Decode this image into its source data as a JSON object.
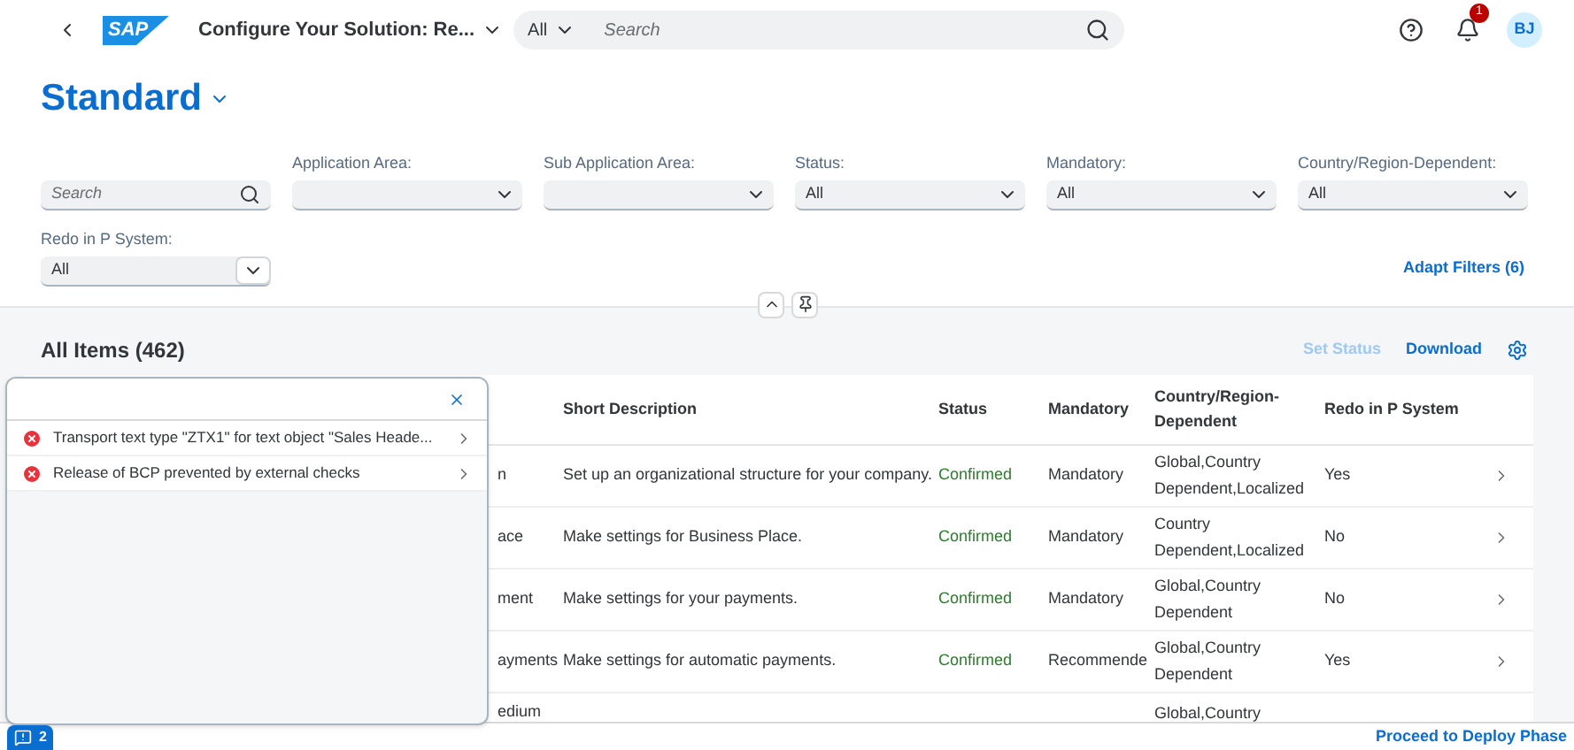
{
  "shell": {
    "logo": "SAP",
    "title": "Configure Your Solution: Re...",
    "search_scope": "All",
    "search_placeholder": "Search",
    "notification_count": "1",
    "avatar": "BJ"
  },
  "variant": {
    "title": "Standard"
  },
  "filters": [
    {
      "kind": "search",
      "placeholder": "Search"
    },
    {
      "kind": "select",
      "label": "Application Area:"
    },
    {
      "kind": "select",
      "label": "Sub Application Area:"
    },
    {
      "kind": "select",
      "label": "Status:",
      "value": "All"
    },
    {
      "kind": "select",
      "label": "Mandatory:",
      "value": "All"
    },
    {
      "kind": "select",
      "label": "Country/Region-Dependent:",
      "value": "All"
    },
    {
      "kind": "combo",
      "label": "Redo in P System:",
      "value": "All"
    }
  ],
  "adapt_filters": "Adapt Filters (6)",
  "table": {
    "title": "All Items (462)",
    "actions": [
      {
        "label": "Set Status",
        "disabled": true
      },
      {
        "label": "Download",
        "disabled": false
      }
    ],
    "columns": [
      "Short Description",
      "Status",
      "Mandatory",
      "Country/Region-Dependent",
      "Redo in P System"
    ],
    "rows": [
      {
        "column_1": "n",
        "description": "Set up an organizational structure for your company.",
        "status": "Confirmed",
        "mandatory": "Mandatory",
        "country": "Global,Country Dependent,Localized",
        "redo": "Yes"
      },
      {
        "column_1": "ace",
        "description": "Make settings for Business Place.",
        "status": "Confirmed",
        "mandatory": "Mandatory",
        "country": "Country Dependent,Localized",
        "redo": "No"
      },
      {
        "column_1": "ment",
        "description": "Make settings for your payments.",
        "status": "Confirmed",
        "mandatory": "Mandatory",
        "country": "Global,Country Dependent",
        "redo": "No"
      },
      {
        "column_1": "ayments",
        "description": "Make settings for automatic payments.",
        "status": "Confirmed",
        "mandatory": "Recommende",
        "country": "Global,Country Dependent",
        "redo": "Yes"
      },
      {
        "column_1": "edium",
        "country": "Global,Country"
      }
    ]
  },
  "messages": {
    "items": [
      {
        "kind": "error",
        "text": "Transport text type \"ZTX1\" for text object \"Sales Heade..."
      },
      {
        "kind": "error",
        "text": "Release of BCP prevented by external checks"
      }
    ],
    "count": "2"
  },
  "footer": {
    "action": "Proceed to Deploy Phase"
  }
}
